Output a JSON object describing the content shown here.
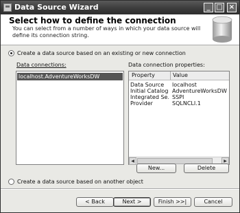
{
  "window": {
    "title": "Data Source Wizard"
  },
  "header": {
    "title": "Select how to define the connection",
    "description": "You can select from a number of ways in which your data source will define its connection string."
  },
  "options": {
    "existing_label": "Create a data source based on an existing or new connection",
    "another_object_label": "Create a data source based on another object"
  },
  "connections": {
    "label": "Data connections:",
    "items": [
      {
        "label": "localhost.AdventureWorksDW",
        "selected": true
      }
    ]
  },
  "properties": {
    "label": "Data connection properties:",
    "columns": [
      "Property",
      "Value"
    ],
    "rows": [
      {
        "property": "Data Source",
        "value": "localhost"
      },
      {
        "property": "Initial Catalog",
        "value": "AdventureWorksDW"
      },
      {
        "property": "Integrated Se...",
        "value": "SSPI"
      },
      {
        "property": "Provider",
        "value": "SQLNCLI.1"
      }
    ]
  },
  "buttons": {
    "new": "New...",
    "delete": "Delete",
    "back": "< Back",
    "next": "Next >",
    "finish": "Finish >>|",
    "cancel": "Cancel"
  },
  "icons": {
    "window": "wizard-window-icon",
    "header": "database-cylinder-icon",
    "minimize": "minimize-icon",
    "maximize": "maximize-icon",
    "close": "close-icon"
  }
}
